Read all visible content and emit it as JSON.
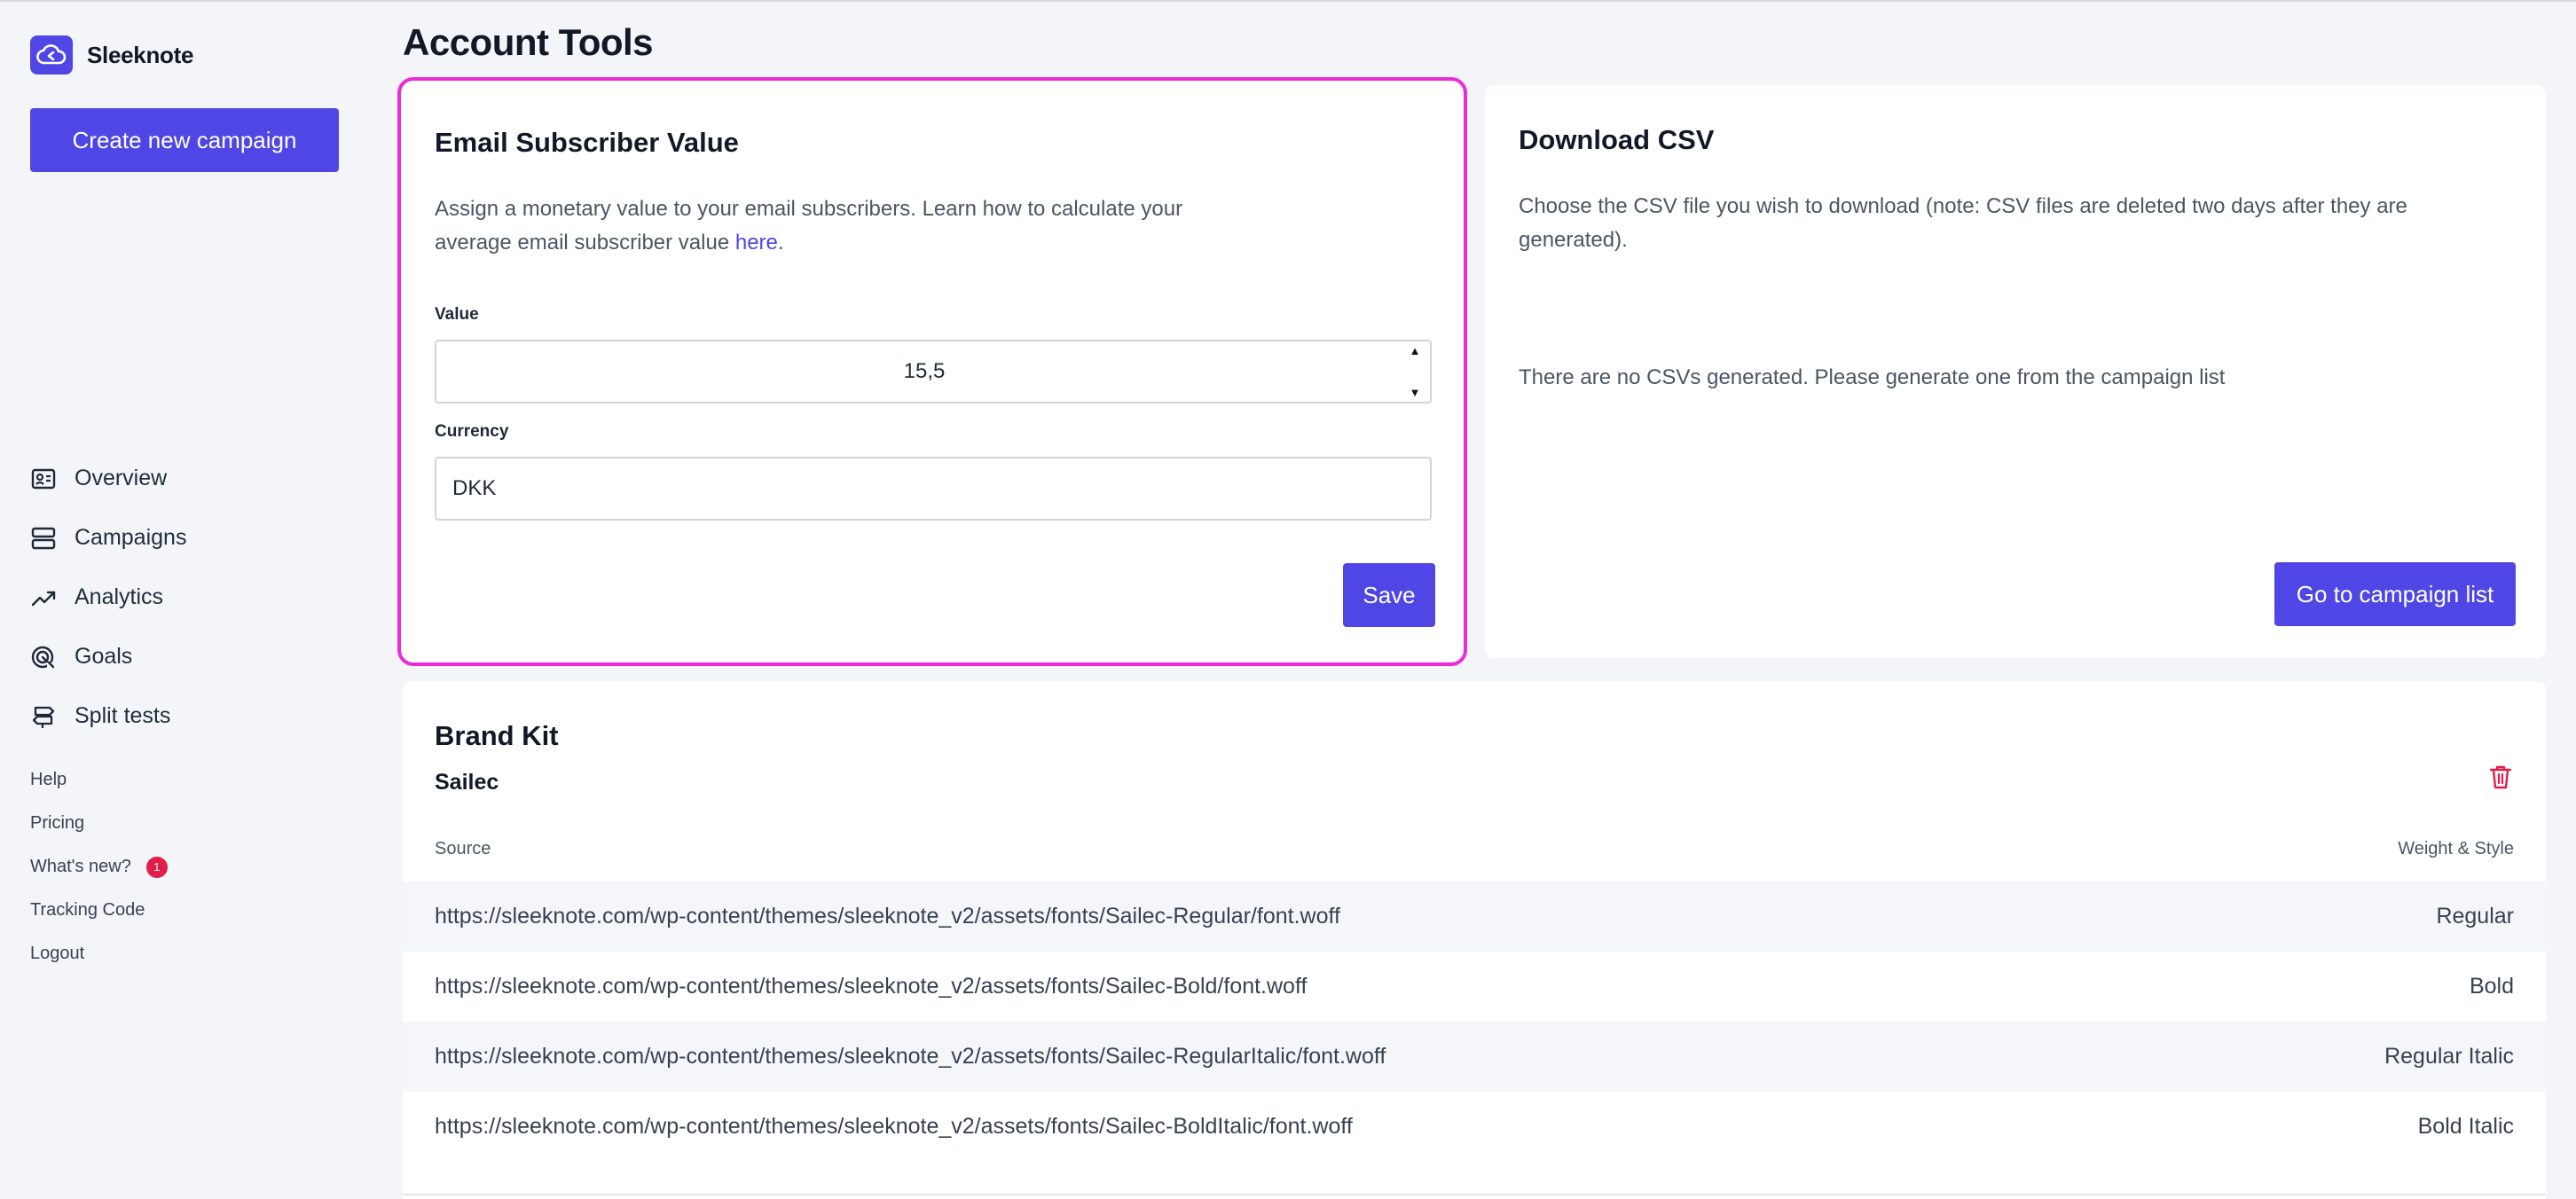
{
  "app": {
    "name": "Sleeknote",
    "logo_icon": "cloud-icon"
  },
  "sidebar": {
    "create_button": "Create new campaign",
    "nav": [
      {
        "label": "Overview",
        "icon": "overview-icon"
      },
      {
        "label": "Campaigns",
        "icon": "campaigns-icon"
      },
      {
        "label": "Analytics",
        "icon": "analytics-icon"
      },
      {
        "label": "Goals",
        "icon": "goals-icon"
      },
      {
        "label": "Split tests",
        "icon": "split-tests-icon"
      }
    ],
    "links": [
      {
        "label": "Help"
      },
      {
        "label": "Pricing"
      },
      {
        "label": "What's new?",
        "badge": "1"
      },
      {
        "label": "Tracking Code"
      },
      {
        "label": "Logout"
      }
    ]
  },
  "page": {
    "title": "Account Tools"
  },
  "email_value_card": {
    "title": "Email Subscriber Value",
    "description": "Assign a monetary value to your email subscribers. Learn how to calculate your average email subscriber value ",
    "link_text": "here",
    "description_end": ".",
    "value_label": "Value",
    "value": "15,5",
    "currency_label": "Currency",
    "currency": "DKK",
    "save_button": "Save",
    "highlight_color": "#ec2bd8"
  },
  "csv_card": {
    "title": "Download CSV",
    "description": "Choose the CSV file you wish to download (note: CSV files are deleted two days after they are generated).",
    "note": "There are no CSVs generated. Please generate one from the campaign list",
    "button": "Go to campaign list"
  },
  "brand_kit": {
    "title": "Brand Kit",
    "font_name": "Sailec",
    "columns": {
      "source": "Source",
      "weight": "Weight & Style"
    },
    "rows": [
      {
        "source": "https://sleeknote.com/wp-content/themes/sleeknote_v2/assets/fonts/Sailec-Regular/font.woff",
        "weight": "Regular"
      },
      {
        "source": "https://sleeknote.com/wp-content/themes/sleeknote_v2/assets/fonts/Sailec-Bold/font.woff",
        "weight": "Bold"
      },
      {
        "source": "https://sleeknote.com/wp-content/themes/sleeknote_v2/assets/fonts/Sailec-RegularItalic/font.woff",
        "weight": "Regular Italic"
      },
      {
        "source": "https://sleeknote.com/wp-content/themes/sleeknote_v2/assets/fonts/Sailec-BoldItalic/font.woff",
        "weight": "Bold Italic"
      }
    ]
  },
  "colors": {
    "accent": "#4f46e5",
    "danger": "#e11d48",
    "background": "#f4f5f8"
  }
}
